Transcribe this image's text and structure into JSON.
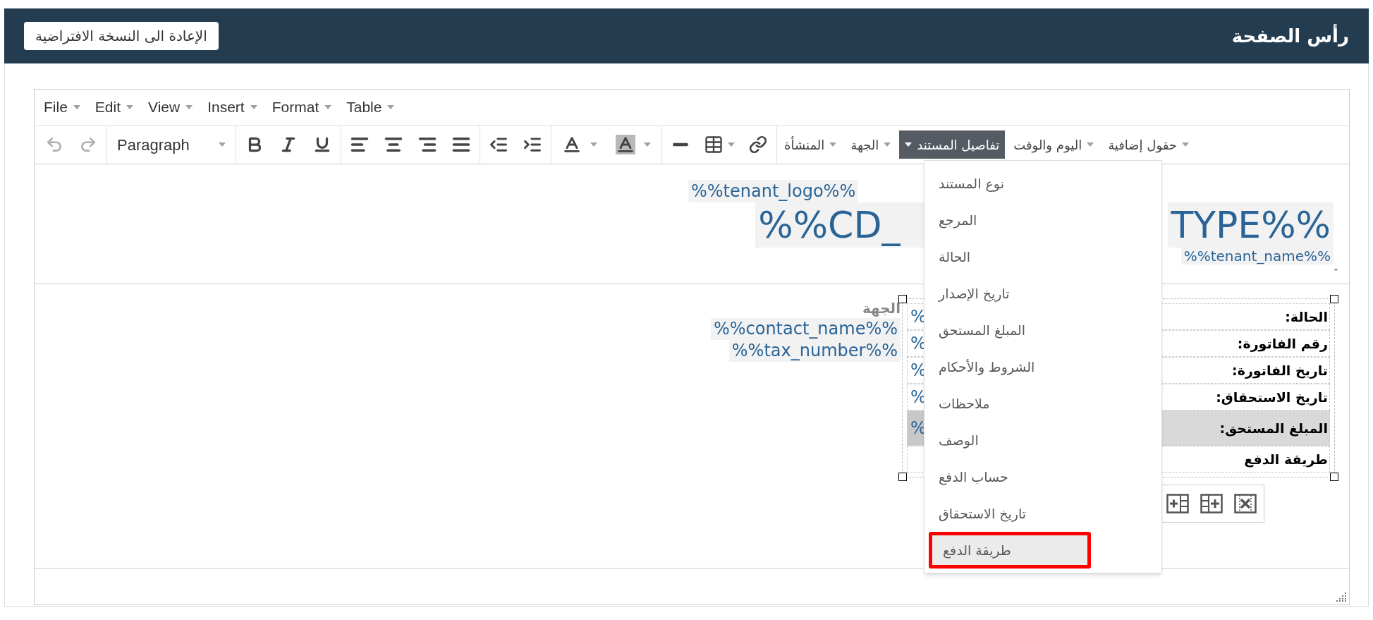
{
  "header": {
    "title": "رأس الصفحة",
    "reset_button": "الإعادة الى النسخة الافتراضية"
  },
  "editor": {
    "menubar": [
      {
        "label": "Table"
      },
      {
        "label": "Format"
      },
      {
        "label": "Insert"
      },
      {
        "label": "View"
      },
      {
        "label": "Edit"
      },
      {
        "label": "File"
      }
    ],
    "toolbar": {
      "undo": {
        "disabled": true
      },
      "redo": {
        "disabled": true
      },
      "block_format": "Paragraph",
      "custom_menus": [
        {
          "label": "حقول إضافية",
          "selected": false
        },
        {
          "label": "اليوم والوقت",
          "selected": false
        },
        {
          "label": "تفاصيل المستند",
          "selected": true
        },
        {
          "label": "الجهة",
          "selected": false
        },
        {
          "label": "المنشأة",
          "selected": false
        }
      ]
    },
    "header_content": {
      "logo_tag": "%%tenant_logo%%",
      "title_tag_start": "%%CD_",
      "title_tag_end": "TYPE%%",
      "name_tag": "%%tenant_name%%",
      "dash": "-"
    },
    "contact": {
      "label": "الجهة",
      "tags": [
        "%%contact_name%%",
        "%%tax_number%%"
      ]
    },
    "details_table": {
      "rows": [
        {
          "label": "الحالة:",
          "value": "%",
          "selected": false
        },
        {
          "label": "رقم الفاتورة:",
          "value": "%",
          "selected": false
        },
        {
          "label": "تاريخ الفاتورة:",
          "value": "%",
          "selected": false
        },
        {
          "label": "تاريخ الاستحقاق:",
          "value": "%",
          "selected": false
        },
        {
          "label": "المبلغ المستحق:",
          "value": "%",
          "selected": true
        },
        {
          "label": "طريقة الدفع",
          "selected": false
        }
      ]
    },
    "dropdown": {
      "items": [
        {
          "label": "نوع المستند",
          "selected": false
        },
        {
          "label": "المرجع",
          "selected": false
        },
        {
          "label": "الحالة",
          "selected": false
        },
        {
          "label": "تاريخ الإصدار",
          "selected": false
        },
        {
          "label": "المبلغ المستحق",
          "selected": false
        },
        {
          "label": "الشروط والأحكام",
          "selected": false
        },
        {
          "label": "ملاحظات",
          "selected": false
        },
        {
          "label": "الوصف",
          "selected": false
        },
        {
          "label": "حساب الدفع",
          "selected": false
        },
        {
          "label": "تاريخ الاستحقاق",
          "selected": false
        },
        {
          "label": "طريقة الدفع",
          "selected": true
        }
      ]
    }
  }
}
